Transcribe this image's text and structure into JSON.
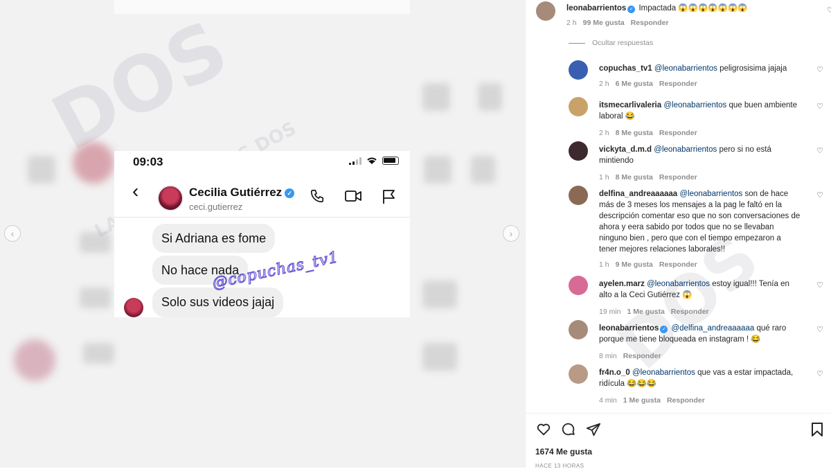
{
  "screenshot": {
    "time": "09:03",
    "contact_name": "Cecilia Gutiérrez",
    "contact_handle": "ceci.gutierrez",
    "messages": [
      "Si Adriana es fome",
      "No hace nada",
      "Solo sus videos jajaj"
    ],
    "sticker": "@copuchas_tv1"
  },
  "watermark": {
    "logo": "DOS",
    "tagline": "LA RADIO DE LOS DOS"
  },
  "post": {
    "author": "leonabarrientos",
    "caption": "Impactada 😱😱😱😱😱😱😱",
    "time": "2 h",
    "likes": "99 Me gusta",
    "reply_label": "Responder",
    "hide_replies": "Ocultar respuestas"
  },
  "replies": [
    {
      "user": "copuchas_tv1",
      "mention": "@leonabarrientos",
      "text": "peligrosisima jajaja",
      "time": "2 h",
      "likes": "6 Me gusta",
      "avatar_color": "#3a5fb0"
    },
    {
      "user": "itsmecarlivaleria",
      "mention": "@leonabarrientos",
      "text": "que buen ambiente laboral 😂",
      "time": "2 h",
      "likes": "8 Me gusta",
      "avatar_color": "#c9a26a"
    },
    {
      "user": "vickyta_d.m.d",
      "mention": "@leonabarrientos",
      "text": "pero si no está mintiendo",
      "time": "1 h",
      "likes": "8 Me gusta",
      "avatar_color": "#3d2a2f"
    },
    {
      "user": "delfina_andreaaaaaa",
      "mention": "@leonabarrientos",
      "text": "son de hace más de 3 meses los mensajes a la pag le faltó en la descripción comentar eso que no son conversaciones de ahora y eera sabido por todos que no se llevaban ninguno bien , pero que con el tiempo empezaron a tener mejores relaciones laborales!!",
      "time": "1 h",
      "likes": "9 Me gusta",
      "avatar_color": "#8a6a55"
    },
    {
      "user": "ayelen.marz",
      "mention": "@leonabarrientos",
      "text": "estoy igual!!! Tenía en alto a la Ceci Gutiérrez 😱",
      "time": "19 min",
      "likes": "1 Me gusta",
      "avatar_color": "#d86a96"
    },
    {
      "user": "leonabarrientos",
      "mention": "@delfina_andreaaaaaa",
      "text": "qué raro porque me tiene bloqueada en instagram ! 😂",
      "time": "8 min",
      "likes": "",
      "avatar_color": "#a78b7a",
      "verified": true
    },
    {
      "user": "fr4n.o_0",
      "mention": "@leonabarrientos",
      "text": "que vas a estar impactada, ridícula 😂😂😂",
      "time": "4 min",
      "likes": "1 Me gusta",
      "avatar_color": "#b89a86"
    }
  ],
  "footer": {
    "likes": "1674 Me gusta",
    "time_ago": "HACE 13 HORAS"
  },
  "colors": {
    "mention": "#00376b",
    "verified": "#3897f0",
    "meta": "#8e8e8e"
  }
}
